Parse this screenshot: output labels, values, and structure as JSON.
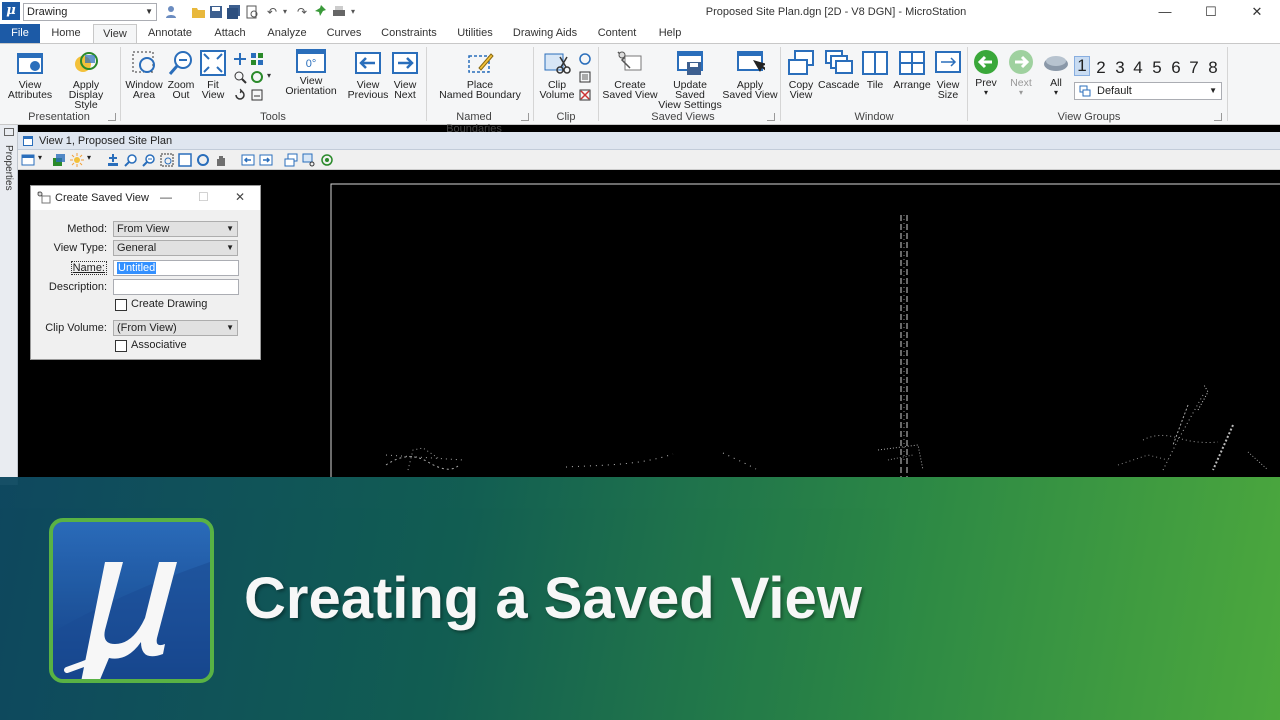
{
  "titlebar": {
    "workspace_value": "Drawing",
    "window_title": "Proposed Site Plan.dgn [2D - V8 DGN] - MicroStation"
  },
  "menu_tabs": [
    "File",
    "Home",
    "View",
    "Annotate",
    "Attach",
    "Analyze",
    "Curves",
    "Constraints",
    "Utilities",
    "Drawing Aids",
    "Content",
    "Help"
  ],
  "active_tab": "View",
  "ribbon": {
    "groups": {
      "presentation": "Presentation",
      "tools": "Tools",
      "named_boundaries": "Named Boundaries",
      "clip": "Clip",
      "saved_views": "Saved Views",
      "window": "Window",
      "view_groups": "View Groups"
    },
    "buttons": {
      "view_attributes": [
        "View",
        "Attributes"
      ],
      "apply_display_style": [
        "Apply",
        "Display Style"
      ],
      "window_area": [
        "Window",
        "Area"
      ],
      "zoom_out": [
        "Zoom",
        "Out"
      ],
      "fit_view": [
        "Fit",
        "View"
      ],
      "view_orientation": [
        "View",
        "Orientation"
      ],
      "view_orientation_value": "0°",
      "view_previous": [
        "View",
        "Previous"
      ],
      "view_next": [
        "View",
        "Next"
      ],
      "place_named_boundary": [
        "Place",
        "Named Boundary"
      ],
      "clip_volume": [
        "Clip",
        "Volume"
      ],
      "create_saved_view": [
        "Create",
        "Saved View"
      ],
      "update_saved_view": [
        "Update Saved",
        "View Settings"
      ],
      "apply_saved_view": [
        "Apply",
        "Saved View"
      ],
      "copy_view": [
        "Copy",
        "View"
      ],
      "cascade": [
        "Cascade"
      ],
      "tile": [
        "Tile"
      ],
      "arrange": [
        "Arrange"
      ],
      "view_size": [
        "View",
        "Size"
      ],
      "prev": [
        "Prev"
      ],
      "next": [
        "Next"
      ],
      "all": [
        "All"
      ]
    },
    "view_numbers": [
      "1",
      "2",
      "3",
      "4",
      "5",
      "6",
      "7",
      "8"
    ],
    "view_group_value": "Default"
  },
  "view": {
    "title": "View 1, Proposed Site Plan",
    "side_panel_label": "Properties"
  },
  "dialog": {
    "title": "Create Saved View",
    "method_label": "Method:",
    "method_value": "From View",
    "view_type_label": "View Type:",
    "view_type_value": "General",
    "name_label": "Name:",
    "name_value": "Untitled",
    "description_label": "Description:",
    "description_value": "",
    "create_drawing_label": "Create Drawing",
    "clip_volume_label": "Clip Volume:",
    "clip_volume_value": "(From View)",
    "associative_label": "Associative"
  },
  "banner": {
    "title": "Creating a Saved View"
  },
  "colors": {
    "accent": "#1c5aa6",
    "canvas": "#000000",
    "banner_start": "#0f4a62",
    "banner_end": "#4fae3f",
    "logo_border": "#5cb847"
  }
}
